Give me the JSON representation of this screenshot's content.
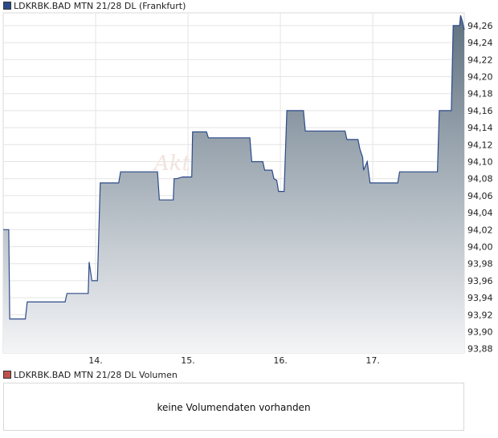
{
  "price_legend": {
    "label": "LDKRBK.BAD MTN 21/28 DL (Frankfurt)",
    "color": "#2c4a8a"
  },
  "volume_legend": {
    "label": "LDKRBK.BAD MTN 21/28 DL Volumen",
    "color": "#c0504d"
  },
  "watermark": "Akt",
  "volume_panel": {
    "message": "keine Volumendaten vorhanden"
  },
  "chart_data": {
    "type": "area",
    "title": "LDKRBK.BAD MTN 21/28 DL (Frankfurt)",
    "xlabel": "",
    "ylabel": "",
    "x_tick_labels": [
      "14.",
      "15.",
      "16.",
      "17."
    ],
    "y_tick_labels": [
      "93,88",
      "93,90",
      "93,92",
      "93,94",
      "93,96",
      "93,98",
      "94,00",
      "94,02",
      "94,04",
      "94,06",
      "94,08",
      "94,10",
      "94,12",
      "94,14",
      "94,16",
      "94,18",
      "94,20",
      "94,22",
      "94,24",
      "94,26"
    ],
    "ylim": [
      93.875,
      94.275
    ],
    "xlim": [
      13.0,
      17.99
    ],
    "grid": true,
    "line_color": "#2c4a8a",
    "fill_top_color": "#5f7180",
    "fill_bottom_color": "#f4f5f7",
    "series": [
      {
        "name": "",
        "x": [
          13.0,
          13.06,
          13.07,
          13.24,
          13.26,
          13.67,
          13.69,
          13.92,
          13.93,
          13.96,
          14.02,
          14.05,
          14.07,
          14.25,
          14.27,
          14.67,
          14.69,
          14.84,
          14.85,
          14.88,
          14.94,
          15.04,
          15.05,
          15.2,
          15.22,
          15.67,
          15.69,
          15.81,
          15.83,
          15.91,
          15.93,
          15.96,
          15.98,
          16.04,
          16.07,
          16.1,
          16.12,
          16.25,
          16.27,
          16.7,
          16.72,
          16.84,
          16.86,
          16.89,
          16.9,
          16.94,
          16.97,
          17.05,
          17.08,
          17.27,
          17.29,
          17.7,
          17.72,
          17.85,
          17.87,
          17.94,
          17.95,
          17.97,
          17.99
        ],
        "y": [
          94.02,
          94.02,
          93.915,
          93.915,
          93.935,
          93.935,
          93.945,
          93.945,
          93.982,
          93.96,
          93.96,
          94.075,
          94.075,
          94.075,
          94.088,
          94.088,
          94.055,
          94.055,
          94.08,
          94.08,
          94.082,
          94.082,
          94.135,
          94.135,
          94.128,
          94.128,
          94.1,
          94.1,
          94.09,
          94.09,
          94.08,
          94.078,
          94.065,
          94.065,
          94.16,
          94.16,
          94.16,
          94.16,
          94.136,
          94.136,
          94.126,
          94.126,
          94.115,
          94.105,
          94.09,
          94.1,
          94.075,
          94.075,
          94.075,
          94.075,
          94.088,
          94.088,
          94.16,
          94.16,
          94.26,
          94.26,
          94.272,
          94.265,
          94.255
        ]
      }
    ]
  }
}
